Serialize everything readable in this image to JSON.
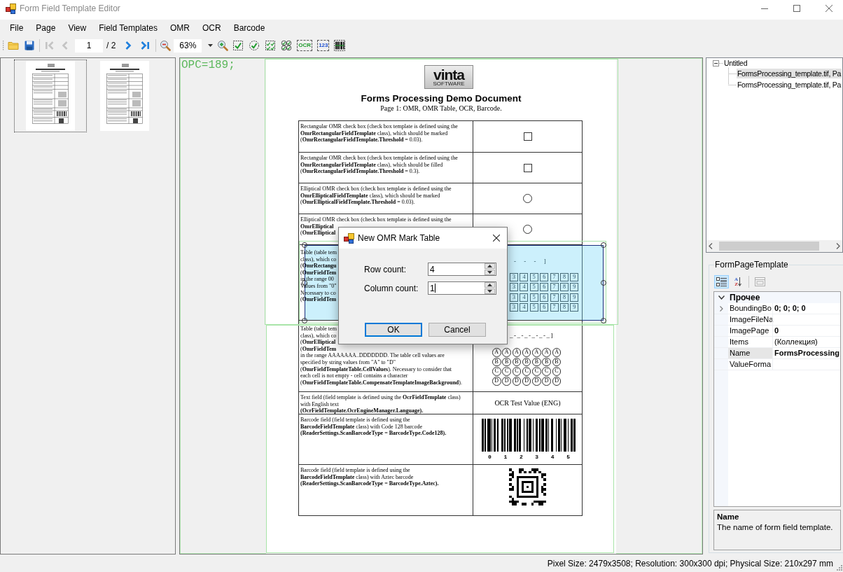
{
  "window": {
    "title": "Form Field Template Editor"
  },
  "menu": [
    "File",
    "Page",
    "View",
    "Field Templates",
    "OMR",
    "OCR",
    "Barcode"
  ],
  "toolbar": {
    "file_tools": [
      {
        "kind": "open"
      },
      {
        "kind": "save"
      }
    ],
    "navigation": {
      "first": {
        "disabled": true
      },
      "previous": {
        "disabled": true
      },
      "page": "1",
      "page_count": "/ 2",
      "next": {
        "disabled": false
      },
      "last": {
        "disabled": false
      }
    },
    "zoom": "63%",
    "field_tools": [
      {
        "kind": "rect_omr"
      },
      {
        "kind": "ellipse_omr"
      },
      {
        "kind": "rect_omr_table"
      },
      {
        "kind": "ellipse_omr_table"
      },
      {
        "kind": "ocr",
        "label": "OCR"
      },
      {
        "kind": "number",
        "label": "123"
      },
      {
        "kind": "barcode"
      }
    ]
  },
  "thumbnails": [
    {
      "selected": true
    },
    {
      "selected": false
    }
  ],
  "viewer": {
    "overlay_text": "OPC=189;",
    "page": {
      "logo": {
        "name": "vinta",
        "tagline": "SOFTWARE"
      },
      "title": "Forms Processing Demo Document",
      "subtitle": "Page 1: OMR, OMR Table, OCR, Barcode.",
      "rows": [
        {
          "kind": "square_box",
          "selected": false,
          "paragraphs": [
            [
              "Rectangular OMR check box (check box template is defined using the",
              "**OmrRectangularFieldTemplate** class), which should be marked",
              "(**OmrRectangularFieldTemplate.Threshold** = 0.03)."
            ]
          ]
        },
        {
          "kind": "square_box",
          "selected": false,
          "paragraphs": [
            [
              "Rectangular OMR check box (check box template is defined using the",
              "**OmrRectangularFieldTemplate** class), which should be filled",
              "(**OmrRectangularFieldTemplate.Threshold** = 0.3)."
            ]
          ]
        },
        {
          "kind": "circle_box",
          "selected": false,
          "paragraphs": [
            [
              "Elliptical OMR check box (check box template is defined using the",
              "**OmrEllipticalFieldTemplate** class), which should be marked",
              "(**OmrEllipticalFieldTemplate.Threshold** = 0.03)."
            ]
          ]
        },
        {
          "kind": "circle_box",
          "selected": false,
          "paragraphs": [
            [
              "Elliptical OMR check box (check box template is defined using the"
            ],
            [
              "**OmrElliptical**",
              "(**OmrElliptical**"
            ]
          ]
        },
        {
          "kind": "digit_table",
          "selected": true,
          "paragraphs": [
            [
              "Table (table tem",
              "class), which co",
              "(**OmrRectangu**",
              "(**OmrFieldTem**",
              "in the range 00",
              "Values from \"0\"",
              "Necessary to co",
              "(**OmrFieldTem**"
            ]
          ],
          "header": "- - - ]",
          "grid": [
            [
              "3",
              "4",
              "5",
              "6",
              "7",
              "8",
              "9"
            ],
            [
              "3",
              "4",
              "5",
              "6",
              "7",
              "8",
              "9"
            ],
            [
              "3",
              "4",
              "5",
              "6",
              "7",
              "8",
              "9"
            ],
            [
              "3",
              "4",
              "5",
              "6",
              "7",
              "8",
              "9"
            ]
          ]
        },
        {
          "kind": "bubble_table",
          "selected": false,
          "paragraphs": [
            [
              "Table (table tem",
              "class), which co",
              "(**OmrElliptical**",
              "(**OmrFieldTem**"
            ],
            [
              "in the range AAAAAAA..DDDDDDD. The table cell values are",
              "specified by string values from \"A\" to \"D\"",
              "(**OmrFieldTemplateTable.CellValues**). Necessary to consider that",
              "each cell is not empty - cell contains a character",
              "(**OmrFieldTemplateTable.CompensateTemplateImageBackground**)."
            ]
          ],
          "header": "_-_-_-_-_-_]",
          "grid": [
            [
              "A",
              "A",
              "A",
              "A",
              "A",
              "A",
              "A"
            ],
            [
              "B",
              "B",
              "B",
              "B",
              "B",
              "B",
              "B"
            ],
            [
              "C",
              "C",
              "C",
              "C",
              "C",
              "C",
              "C"
            ],
            [
              "D",
              "D",
              "D",
              "D",
              "D",
              "D",
              "D"
            ]
          ]
        },
        {
          "kind": "ocr_text",
          "selected": false,
          "paragraphs": [
            [
              "Text field (field template is defined using the **OcrFieldTemplate** class)",
              "with English text",
              "**(OcrFieldTemplate.OcrEngineManager.Language).**"
            ]
          ],
          "value": "OCR Test Value (ENG)"
        },
        {
          "kind": "barcode",
          "selected": false,
          "paragraphs": [
            [
              "Barcode field (field template is defined using the",
              "**BarcodeFieldTemplate** class) with Code 128 barcode",
              "**(ReaderSettings.ScanBarcodeType = BarcodeType.Code128).**"
            ]
          ],
          "digits": [
            "0",
            "1",
            "2",
            "3",
            "4",
            "5"
          ]
        },
        {
          "kind": "aztec",
          "selected": false,
          "paragraphs": [
            [
              "Barcode field (field template is defined using the",
              "**BarcodeFieldTemplate** class) with Aztec barcode",
              "**(ReaderSettings.ScanBarcodeType = BarcodeType.Aztec).**"
            ]
          ]
        }
      ]
    }
  },
  "dialog": {
    "title": "New OMR Mark Table",
    "fields": [
      {
        "label": "Row count:",
        "value": "4",
        "focused": false
      },
      {
        "label": "Column count:",
        "value": "1",
        "focused": true
      }
    ],
    "buttons": [
      {
        "label": "OK",
        "default": true
      },
      {
        "label": "Cancel",
        "default": false
      }
    ]
  },
  "project_tree": {
    "root": {
      "label": "Untitled",
      "expanded": true,
      "selected": false,
      "children": [
        {
          "label": "FormsProcessing_template.tif, Pa",
          "selected": true
        },
        {
          "label": "FormsProcessing_template.tif, Pa",
          "selected": false
        }
      ]
    }
  },
  "properties": {
    "title": "FormPageTemplate",
    "tools": [
      {
        "kind": "categorized",
        "selected": true,
        "disabled": false
      },
      {
        "kind": "alphabetical",
        "letters": [
          "A",
          "Z"
        ],
        "selected": false,
        "disabled": false
      },
      {
        "kind": "property_pages",
        "selected": false,
        "disabled": true
      }
    ],
    "category": {
      "label": "Прочее",
      "expanded": true
    },
    "rows": [
      {
        "label": "BoundingBo",
        "value": "0; 0; 0; 0",
        "modified": true,
        "expandable": true,
        "selected": false
      },
      {
        "label": "ImageFileNa",
        "expandable": false,
        "selected": false
      },
      {
        "label": "ImagePage",
        "value": "0",
        "modified": true,
        "expandable": false,
        "selected": false
      },
      {
        "label": "Items",
        "value": "(Коллекция)",
        "modified": false,
        "expandable": false,
        "selected": false
      },
      {
        "label": "Name",
        "value": "FormsProcessing",
        "modified": true,
        "expandable": false,
        "selected": true
      },
      {
        "label": "ValueForma",
        "expandable": false,
        "selected": false
      }
    ],
    "description": {
      "title": "Name",
      "text": "The name of form field template."
    }
  },
  "status_bar": "Pixel Size: 2479x3508; Resolution: 300x300 dpi; Physical Size: 210x297 mm"
}
